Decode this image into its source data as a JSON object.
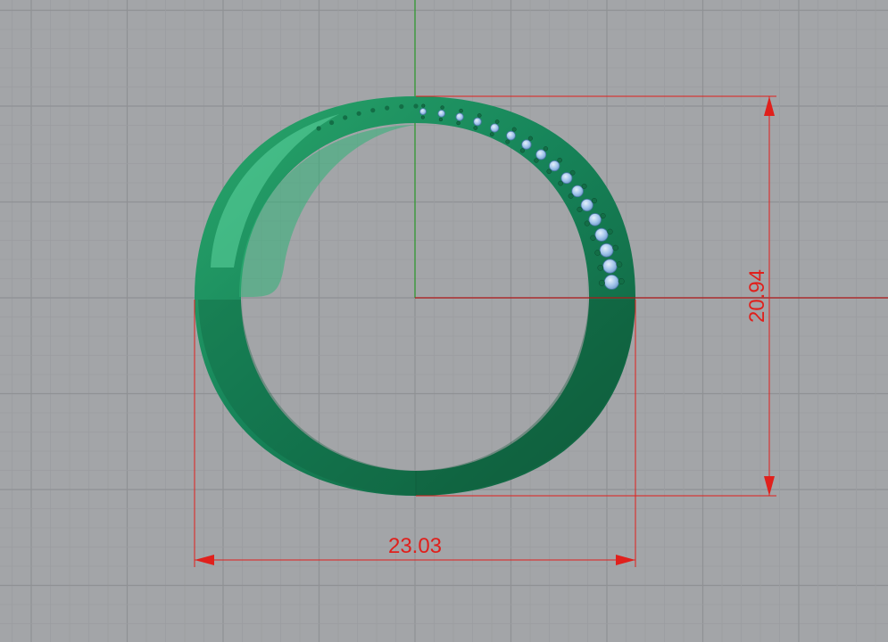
{
  "viewport": {
    "view": "top",
    "background_color": "#a3a5a8",
    "grid_minor_color": "#9b9da0",
    "grid_major_color": "#8f9194",
    "axis_x_color": "#b01818",
    "axis_y_color": "#2a9a2a"
  },
  "model": {
    "name": "ring",
    "band_color": "#17855a",
    "band_highlight_color": "#3fc18a",
    "stone_color": "#9fc3ea",
    "prong_color": "#136e46"
  },
  "dimensions": {
    "color": "#e0201c",
    "width_label": "23.03",
    "height_label": "20.94"
  }
}
